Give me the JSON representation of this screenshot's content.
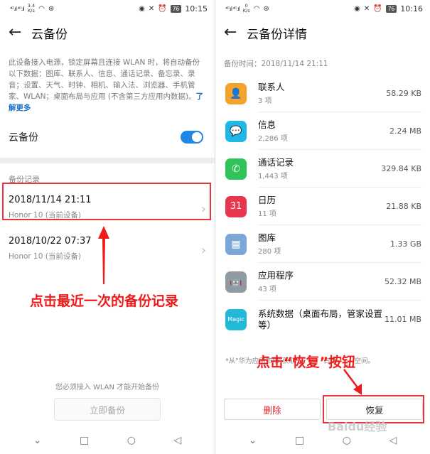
{
  "left": {
    "status": {
      "signal": "⁴ᴳ.ıl ⁴ᴳ.ıl",
      "speed_value": "3.4",
      "speed_unit": "K/s",
      "battery": "76",
      "time": "10:15"
    },
    "appbar": {
      "back_icon": "arrow-left-icon",
      "title": "云备份"
    },
    "description": "此设备接入电源，锁定屏幕且连接 WLAN 时，将自动备份以下数据：图库、联系人、信息、通话记录、备忘录、录音；设置、天气、时钟、相机、输入法、浏览器、手机管家、WLAN；桌面布局与应用 (不含第三方应用内数据)。",
    "learn_more": "了解更多",
    "toggle": {
      "label": "云备份",
      "on": true,
      "color": "#1e88e5"
    },
    "section_title": "备份记录",
    "records": [
      {
        "title": "2018/11/14 21:11",
        "subtitle": "Honor 10 (当前设备)"
      },
      {
        "title": "2018/10/22 07:37",
        "subtitle": "Honor 10 (当前设备)"
      }
    ],
    "annotation": "点击最近一次的备份记录",
    "wlan_note": "您必须接入 WLAN 才能开始备份",
    "backup_button": "立即备份"
  },
  "right": {
    "status": {
      "signal": "⁴ᴳ.ıl ⁴ᴳ.ıl",
      "speed_value": "0",
      "speed_unit": "K/s",
      "battery": "76",
      "time": "10:16"
    },
    "appbar": {
      "back_icon": "arrow-left-icon",
      "title": "云备份详情"
    },
    "backup_time": "备份时间：2018/11/14 21:11",
    "items": [
      {
        "name": "联系人",
        "count": "3 项",
        "size": "58.29 KB",
        "icon": "contacts-icon",
        "color": "#f5a32b",
        "glyph": "👤"
      },
      {
        "name": "信息",
        "count": "2,286 项",
        "size": "2.24 MB",
        "icon": "messages-icon",
        "color": "#1fb6e8",
        "glyph": "💬"
      },
      {
        "name": "通话记录",
        "count": "1,443 项",
        "size": "329.84 KB",
        "icon": "phone-icon",
        "color": "#2fc35a",
        "glyph": "✆"
      },
      {
        "name": "日历",
        "count": "11 项",
        "size": "21.88 KB",
        "icon": "calendar-icon",
        "color": "#e8364e",
        "glyph": "31"
      },
      {
        "name": "图库",
        "count": "280 项",
        "size": "1.33 GB",
        "icon": "gallery-icon",
        "color": "#7aa8d8",
        "glyph": "▦"
      },
      {
        "name": "应用程序",
        "count": "43 项",
        "size": "52.32 MB",
        "icon": "android-icon",
        "color": "#8f9aa3",
        "glyph": "🤖"
      },
      {
        "name": "系统数据（桌面布局，管家设置等）",
        "count": "",
        "size": "11.01 MB",
        "icon": "magic-icon",
        "color": "#22b8d8",
        "glyph": "Magic"
      }
    ],
    "footnote": "*从\"华为应用市场\"获取",
    "footnote_tail": "占用",
    "footnote_end": "空间。",
    "delete_button": "删除",
    "restore_button": "恢复",
    "annotation": "点击“恢复”按钮",
    "watermark": "Baidu经验"
  }
}
